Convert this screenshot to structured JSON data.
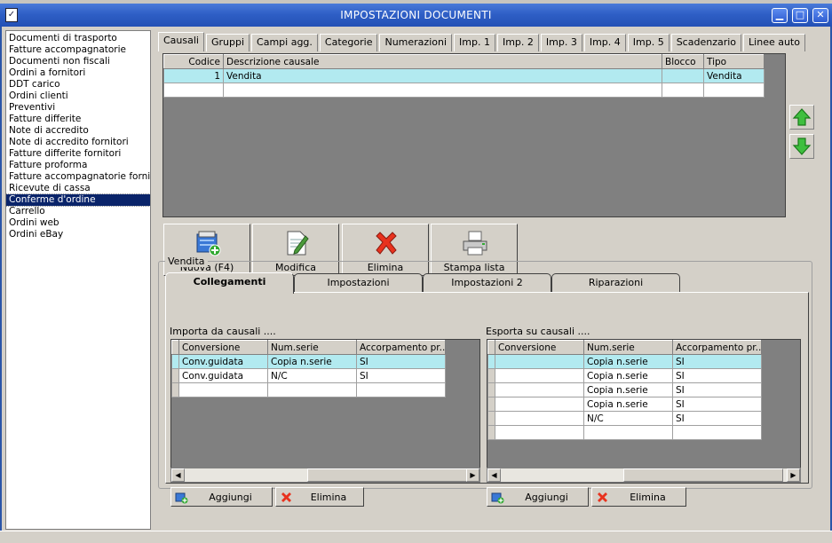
{
  "window": {
    "title": "IMPOSTAZIONI DOCUMENTI",
    "min": "▁",
    "max": "□",
    "close": "✕"
  },
  "doc_types": [
    "Documenti di trasporto",
    "Fatture accompagnatorie",
    "Documenti non fiscali",
    "Ordini a fornitori",
    "DDT carico",
    "Ordini clienti",
    "Preventivi",
    "Fatture differite",
    "Note di accredito",
    "Note di accredito fornitori",
    "Fatture differite fornitori",
    "Fatture proforma",
    "Fatture accompagnatorie fornitori",
    "Ricevute di cassa",
    "Conferme d'ordine",
    "Carrello",
    "Ordini web",
    "Ordini eBay"
  ],
  "selected_doc_type": "Conferme d'ordine",
  "main_tabs": [
    "Causali",
    "Gruppi",
    "Campi agg.",
    "Categorie",
    "Numerazioni",
    "Imp. 1",
    "Imp. 2",
    "Imp. 3",
    "Imp. 4",
    "Imp. 5",
    "Scadenzario",
    "Linee auto"
  ],
  "active_main_tab": "Causali",
  "causali_grid": {
    "columns": [
      "Codice",
      "Descrizione causale",
      "Blocco",
      "Tipo"
    ],
    "rows": [
      {
        "codice": "1",
        "descrizione": "Vendita",
        "blocco": "",
        "tipo": "Vendita"
      }
    ]
  },
  "actions": {
    "new": "Nuova (F4)",
    "edit": "Modifica",
    "delete": "Elimina",
    "print": "Stampa lista"
  },
  "group_label": "Vendita",
  "sub_tabs": [
    "Collegamenti",
    "Impostazioni",
    "Impostazioni 2",
    "Riparazioni"
  ],
  "active_sub_tab": "Collegamenti",
  "import_section": {
    "label": "Importa da causali ....",
    "columns": [
      "Conversione",
      "Num.serie",
      "Accorpamento pr..."
    ],
    "rows": [
      [
        "Conv.guidata",
        "Copia n.serie",
        "SI"
      ],
      [
        "Conv.guidata",
        "N/C",
        "SI"
      ]
    ],
    "add": "Aggiungi",
    "delete": "Elimina"
  },
  "export_section": {
    "label": "Esporta su causali ....",
    "columns": [
      "Conversione",
      "Num.serie",
      "Accorpamento pr..."
    ],
    "rows": [
      [
        "",
        "Copia n.serie",
        "SI"
      ],
      [
        "",
        "Copia n.serie",
        "SI"
      ],
      [
        "",
        "Copia n.serie",
        "SI"
      ],
      [
        "",
        "Copia n.serie",
        "SI"
      ],
      [
        "",
        "N/C",
        "SI"
      ]
    ],
    "add": "Aggiungi",
    "delete": "Elimina"
  },
  "colors": {
    "titlebar": "#2f5fc6",
    "selection": "#0a246a",
    "row_highlight": "#b2eaf0",
    "face": "#d4d0c8"
  }
}
